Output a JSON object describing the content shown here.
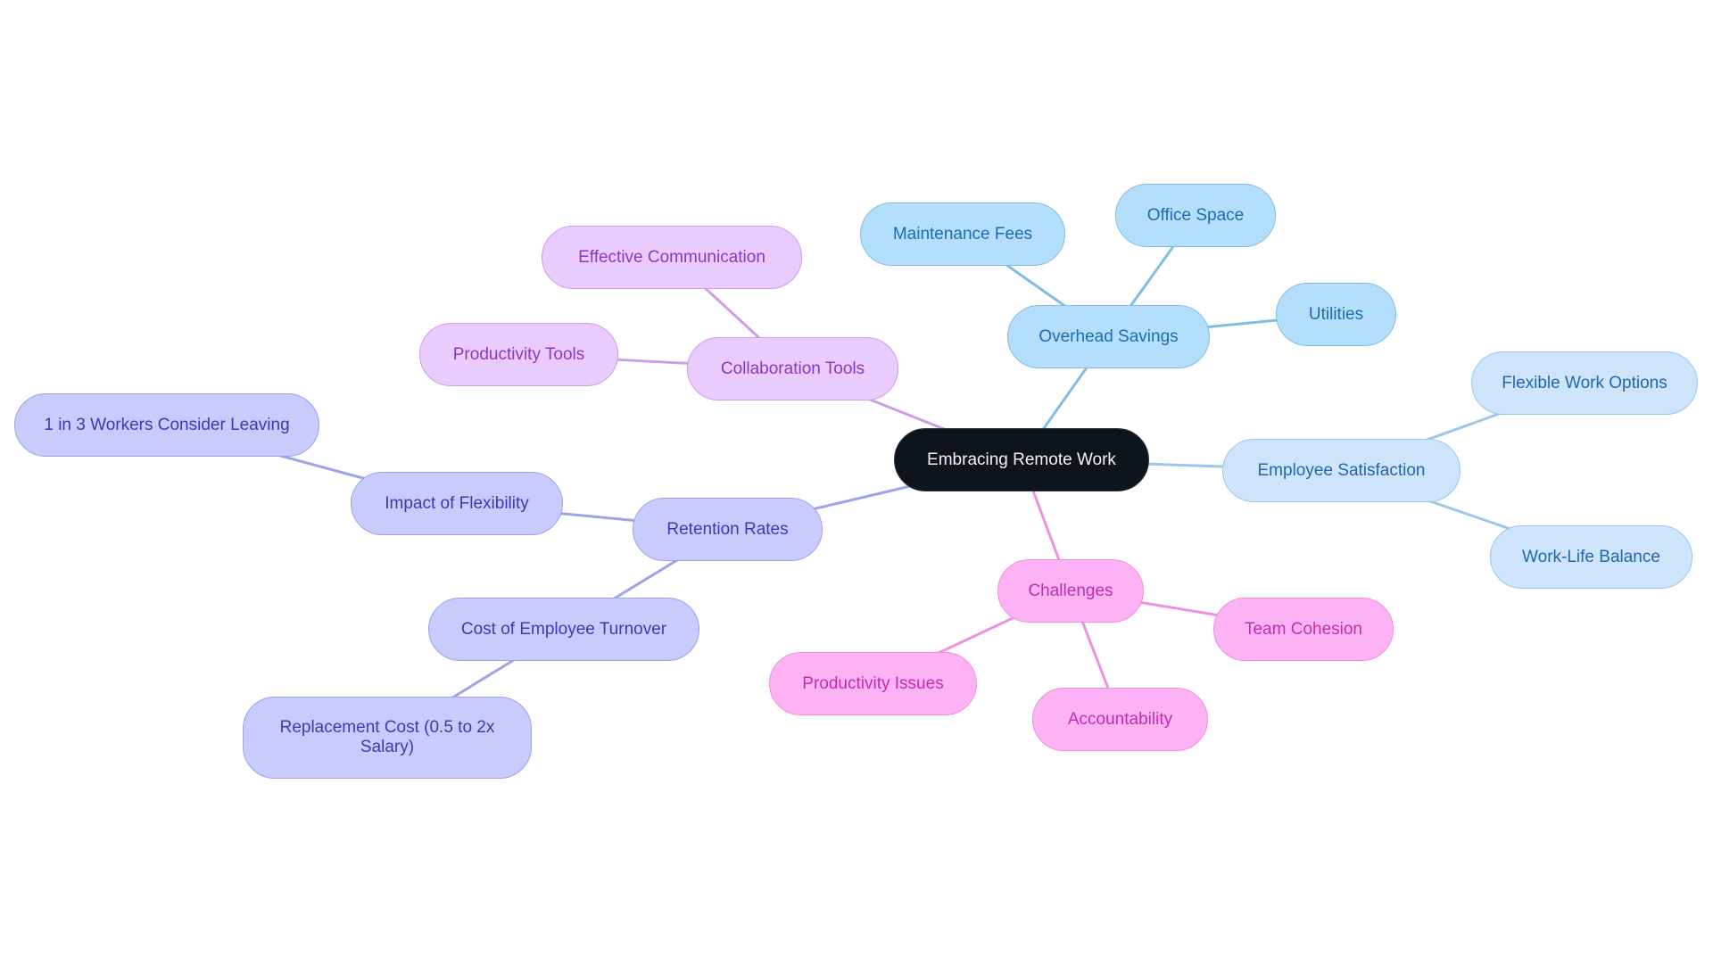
{
  "diagram": {
    "type": "mindmap",
    "root": {
      "id": "root",
      "label": "Embracing Remote Work",
      "color": "#0d141b"
    },
    "branch_colors": {
      "overhead": "#7fbde6",
      "satisfaction": "#9cc6ec",
      "challenges": "#ee8fe0",
      "collaboration": "#cc9ee8",
      "retention": "#9ea2e6"
    },
    "nodes": [
      {
        "id": "root",
        "label": "Embracing Remote Work",
        "branch": "root",
        "parent": null
      },
      {
        "id": "overhead",
        "label": "Overhead Savings",
        "branch": "overhead",
        "parent": "root"
      },
      {
        "id": "maintenance",
        "label": "Maintenance Fees",
        "branch": "overhead",
        "parent": "overhead"
      },
      {
        "id": "office",
        "label": "Office Space",
        "branch": "overhead",
        "parent": "overhead"
      },
      {
        "id": "utilities",
        "label": "Utilities",
        "branch": "overhead",
        "parent": "overhead"
      },
      {
        "id": "satisfaction",
        "label": "Employee Satisfaction",
        "branch": "satisfaction",
        "parent": "root"
      },
      {
        "id": "flexible",
        "label": "Flexible Work Options",
        "branch": "satisfaction",
        "parent": "satisfaction"
      },
      {
        "id": "worklife",
        "label": "Work-Life Balance",
        "branch": "satisfaction",
        "parent": "satisfaction"
      },
      {
        "id": "challenges",
        "label": "Challenges",
        "branch": "challenges",
        "parent": "root"
      },
      {
        "id": "cohesion",
        "label": "Team Cohesion",
        "branch": "challenges",
        "parent": "challenges"
      },
      {
        "id": "prodissues",
        "label": "Productivity Issues",
        "branch": "challenges",
        "parent": "challenges"
      },
      {
        "id": "accountability",
        "label": "Accountability",
        "branch": "challenges",
        "parent": "challenges"
      },
      {
        "id": "collaboration",
        "label": "Collaboration Tools",
        "branch": "collaboration",
        "parent": "root"
      },
      {
        "id": "communication",
        "label": "Effective Communication",
        "branch": "collaboration",
        "parent": "collaboration"
      },
      {
        "id": "prodtools",
        "label": "Productivity Tools",
        "branch": "collaboration",
        "parent": "collaboration"
      },
      {
        "id": "retention",
        "label": "Retention Rates",
        "branch": "retention",
        "parent": "root"
      },
      {
        "id": "impact",
        "label": "Impact of Flexibility",
        "branch": "retention",
        "parent": "retention"
      },
      {
        "id": "onein3",
        "label": "1 in 3 Workers Consider Leaving",
        "branch": "retention",
        "parent": "impact"
      },
      {
        "id": "turnover",
        "label": "Cost of Employee Turnover",
        "branch": "retention",
        "parent": "retention"
      },
      {
        "id": "replacement",
        "label": "Replacement Cost (0.5 to 2x Salary)",
        "branch": "retention",
        "parent": "turnover"
      }
    ]
  }
}
